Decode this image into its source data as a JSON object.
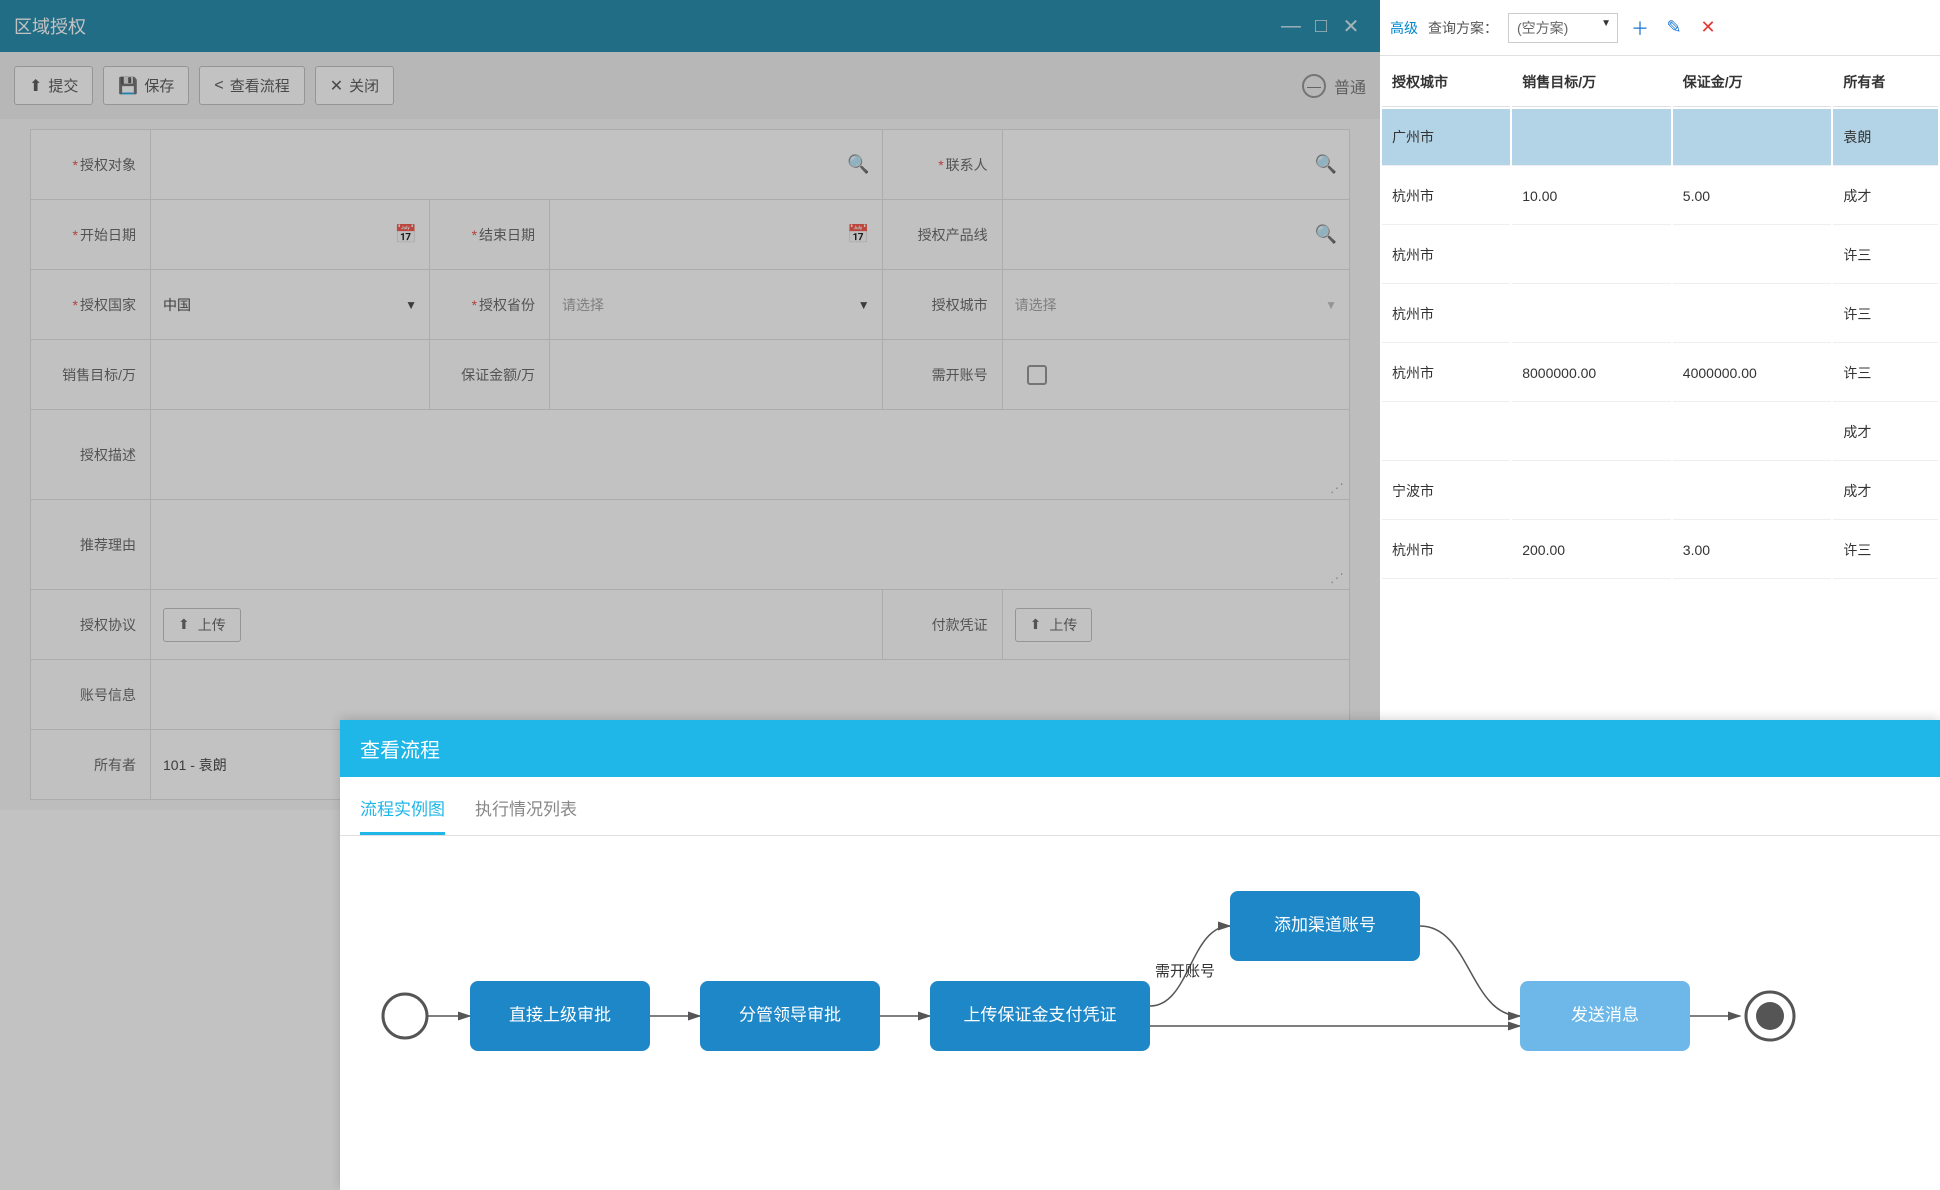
{
  "bg": {
    "advanced_link": "高级",
    "scheme_label": "查询方案：",
    "scheme_value": "(空方案)",
    "columns": [
      "授权城市",
      "销售目标/万",
      "保证金/万",
      "所有者"
    ],
    "rows": [
      {
        "city": "广州市",
        "target": "",
        "deposit": "",
        "owner": "袁朗"
      },
      {
        "city": "杭州市",
        "target": "10.00",
        "deposit": "5.00",
        "owner": "成才"
      },
      {
        "city": "杭州市",
        "target": "",
        "deposit": "",
        "owner": "许三"
      },
      {
        "city": "杭州市",
        "target": "",
        "deposit": "",
        "owner": "许三"
      },
      {
        "city": "杭州市",
        "target": "8000000.00",
        "deposit": "4000000.00",
        "owner": "许三"
      },
      {
        "city": "",
        "target": "",
        "deposit": "",
        "owner": "成才"
      },
      {
        "city": "宁波市",
        "target": "",
        "deposit": "",
        "owner": "成才"
      },
      {
        "city": "杭州市",
        "target": "200.00",
        "deposit": "3.00",
        "owner": "许三"
      }
    ]
  },
  "modal": {
    "title": "区域授权",
    "toolbar": {
      "submit": "提交",
      "save": "保存",
      "view_flow": "查看流程",
      "close": "关闭",
      "mode": "普通"
    },
    "form": {
      "auth_target_lbl": "授权对象",
      "contact_lbl": "联系人",
      "start_date_lbl": "开始日期",
      "end_date_lbl": "结束日期",
      "product_line_lbl": "授权产品线",
      "country_lbl": "授权国家",
      "country_val": "中国",
      "province_lbl": "授权省份",
      "province_ph": "请选择",
      "city_lbl": "授权城市",
      "city_ph": "请选择",
      "sales_target_lbl": "销售目标/万",
      "deposit_lbl": "保证金额/万",
      "need_account_lbl": "需开账号",
      "desc_lbl": "授权描述",
      "reason_lbl": "推荐理由",
      "agreement_lbl": "授权协议",
      "upload": "上传",
      "payment_lbl": "付款凭证",
      "account_info_lbl": "账号信息",
      "owner_lbl": "所有者",
      "owner_val": "101 - 袁朗"
    }
  },
  "flow": {
    "title": "查看流程",
    "tab_diagram": "流程实例图",
    "tab_list": "执行情况列表",
    "edge_label": "需开账号",
    "nodes": {
      "n1": "直接上级审批",
      "n2": "分管领导审批",
      "n3": "上传保证金支付凭证",
      "n4": "添加渠道账号",
      "n5": "发送消息"
    }
  }
}
